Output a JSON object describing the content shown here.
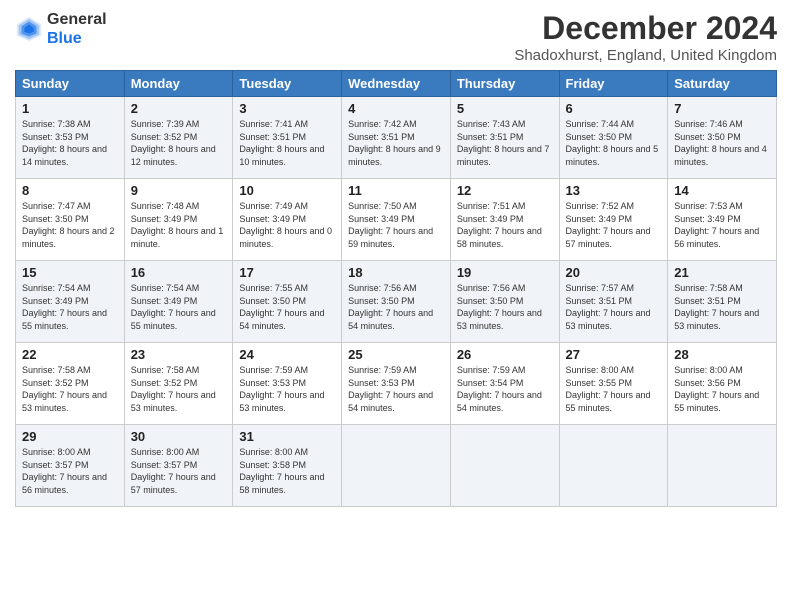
{
  "logo": {
    "line1": "General",
    "line2": "Blue"
  },
  "title": "December 2024",
  "subtitle": "Shadoxhurst, England, United Kingdom",
  "headers": [
    "Sunday",
    "Monday",
    "Tuesday",
    "Wednesday",
    "Thursday",
    "Friday",
    "Saturday"
  ],
  "weeks": [
    [
      {
        "day": "1",
        "sunrise": "Sunrise: 7:38 AM",
        "sunset": "Sunset: 3:53 PM",
        "daylight": "Daylight: 8 hours and 14 minutes."
      },
      {
        "day": "2",
        "sunrise": "Sunrise: 7:39 AM",
        "sunset": "Sunset: 3:52 PM",
        "daylight": "Daylight: 8 hours and 12 minutes."
      },
      {
        "day": "3",
        "sunrise": "Sunrise: 7:41 AM",
        "sunset": "Sunset: 3:51 PM",
        "daylight": "Daylight: 8 hours and 10 minutes."
      },
      {
        "day": "4",
        "sunrise": "Sunrise: 7:42 AM",
        "sunset": "Sunset: 3:51 PM",
        "daylight": "Daylight: 8 hours and 9 minutes."
      },
      {
        "day": "5",
        "sunrise": "Sunrise: 7:43 AM",
        "sunset": "Sunset: 3:51 PM",
        "daylight": "Daylight: 8 hours and 7 minutes."
      },
      {
        "day": "6",
        "sunrise": "Sunrise: 7:44 AM",
        "sunset": "Sunset: 3:50 PM",
        "daylight": "Daylight: 8 hours and 5 minutes."
      },
      {
        "day": "7",
        "sunrise": "Sunrise: 7:46 AM",
        "sunset": "Sunset: 3:50 PM",
        "daylight": "Daylight: 8 hours and 4 minutes."
      }
    ],
    [
      {
        "day": "8",
        "sunrise": "Sunrise: 7:47 AM",
        "sunset": "Sunset: 3:50 PM",
        "daylight": "Daylight: 8 hours and 2 minutes."
      },
      {
        "day": "9",
        "sunrise": "Sunrise: 7:48 AM",
        "sunset": "Sunset: 3:49 PM",
        "daylight": "Daylight: 8 hours and 1 minute."
      },
      {
        "day": "10",
        "sunrise": "Sunrise: 7:49 AM",
        "sunset": "Sunset: 3:49 PM",
        "daylight": "Daylight: 8 hours and 0 minutes."
      },
      {
        "day": "11",
        "sunrise": "Sunrise: 7:50 AM",
        "sunset": "Sunset: 3:49 PM",
        "daylight": "Daylight: 7 hours and 59 minutes."
      },
      {
        "day": "12",
        "sunrise": "Sunrise: 7:51 AM",
        "sunset": "Sunset: 3:49 PM",
        "daylight": "Daylight: 7 hours and 58 minutes."
      },
      {
        "day": "13",
        "sunrise": "Sunrise: 7:52 AM",
        "sunset": "Sunset: 3:49 PM",
        "daylight": "Daylight: 7 hours and 57 minutes."
      },
      {
        "day": "14",
        "sunrise": "Sunrise: 7:53 AM",
        "sunset": "Sunset: 3:49 PM",
        "daylight": "Daylight: 7 hours and 56 minutes."
      }
    ],
    [
      {
        "day": "15",
        "sunrise": "Sunrise: 7:54 AM",
        "sunset": "Sunset: 3:49 PM",
        "daylight": "Daylight: 7 hours and 55 minutes."
      },
      {
        "day": "16",
        "sunrise": "Sunrise: 7:54 AM",
        "sunset": "Sunset: 3:49 PM",
        "daylight": "Daylight: 7 hours and 55 minutes."
      },
      {
        "day": "17",
        "sunrise": "Sunrise: 7:55 AM",
        "sunset": "Sunset: 3:50 PM",
        "daylight": "Daylight: 7 hours and 54 minutes."
      },
      {
        "day": "18",
        "sunrise": "Sunrise: 7:56 AM",
        "sunset": "Sunset: 3:50 PM",
        "daylight": "Daylight: 7 hours and 54 minutes."
      },
      {
        "day": "19",
        "sunrise": "Sunrise: 7:56 AM",
        "sunset": "Sunset: 3:50 PM",
        "daylight": "Daylight: 7 hours and 53 minutes."
      },
      {
        "day": "20",
        "sunrise": "Sunrise: 7:57 AM",
        "sunset": "Sunset: 3:51 PM",
        "daylight": "Daylight: 7 hours and 53 minutes."
      },
      {
        "day": "21",
        "sunrise": "Sunrise: 7:58 AM",
        "sunset": "Sunset: 3:51 PM",
        "daylight": "Daylight: 7 hours and 53 minutes."
      }
    ],
    [
      {
        "day": "22",
        "sunrise": "Sunrise: 7:58 AM",
        "sunset": "Sunset: 3:52 PM",
        "daylight": "Daylight: 7 hours and 53 minutes."
      },
      {
        "day": "23",
        "sunrise": "Sunrise: 7:58 AM",
        "sunset": "Sunset: 3:52 PM",
        "daylight": "Daylight: 7 hours and 53 minutes."
      },
      {
        "day": "24",
        "sunrise": "Sunrise: 7:59 AM",
        "sunset": "Sunset: 3:53 PM",
        "daylight": "Daylight: 7 hours and 53 minutes."
      },
      {
        "day": "25",
        "sunrise": "Sunrise: 7:59 AM",
        "sunset": "Sunset: 3:53 PM",
        "daylight": "Daylight: 7 hours and 54 minutes."
      },
      {
        "day": "26",
        "sunrise": "Sunrise: 7:59 AM",
        "sunset": "Sunset: 3:54 PM",
        "daylight": "Daylight: 7 hours and 54 minutes."
      },
      {
        "day": "27",
        "sunrise": "Sunrise: 8:00 AM",
        "sunset": "Sunset: 3:55 PM",
        "daylight": "Daylight: 7 hours and 55 minutes."
      },
      {
        "day": "28",
        "sunrise": "Sunrise: 8:00 AM",
        "sunset": "Sunset: 3:56 PM",
        "daylight": "Daylight: 7 hours and 55 minutes."
      }
    ],
    [
      {
        "day": "29",
        "sunrise": "Sunrise: 8:00 AM",
        "sunset": "Sunset: 3:57 PM",
        "daylight": "Daylight: 7 hours and 56 minutes."
      },
      {
        "day": "30",
        "sunrise": "Sunrise: 8:00 AM",
        "sunset": "Sunset: 3:57 PM",
        "daylight": "Daylight: 7 hours and 57 minutes."
      },
      {
        "day": "31",
        "sunrise": "Sunrise: 8:00 AM",
        "sunset": "Sunset: 3:58 PM",
        "daylight": "Daylight: 7 hours and 58 minutes."
      },
      null,
      null,
      null,
      null
    ]
  ]
}
